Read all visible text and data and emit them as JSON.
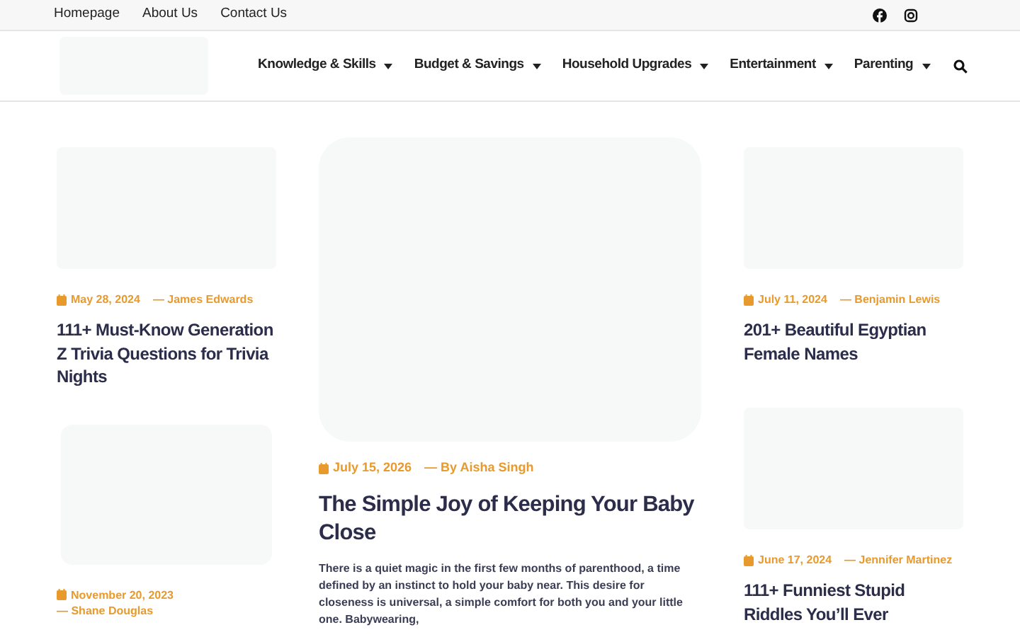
{
  "top_links": [
    "Homepage",
    "About Us",
    "Contact Us"
  ],
  "nav": [
    {
      "label": "Knowledge & Skills"
    },
    {
      "label": "Budget & Savings"
    },
    {
      "label": "Household Upgrades"
    },
    {
      "label": "Entertainment"
    },
    {
      "label": "Parenting"
    }
  ],
  "columns": [
    [
      {
        "date": "May 28, 2024",
        "author": "— James Edwards",
        "title": "111+ Must-Know Generation Z Trivia Questions for Trivia Nights"
      },
      {
        "date": "November 20, 2023",
        "author": "— Shane Douglas"
      }
    ],
    [
      {
        "date": "July 15, 2026",
        "author": "— By Aisha Singh",
        "title": "The Simple Joy of Keeping Your Baby Close",
        "excerpt": "There is a quiet magic in the first few months of parenthood, a time defined by an instinct to hold your baby near. This desire for closeness is universal, a simple comfort for both you and your little one. Babywearing,"
      }
    ],
    [
      {
        "date": "July 11, 2024",
        "author": "— Benjamin Lewis",
        "title": "201+ Beautiful Egyptian Female Names"
      },
      {
        "date": "June 17, 2024",
        "author": "— Jennifer Martinez",
        "title": "111+ Funniest Stupid Riddles You’ll Ever"
      }
    ]
  ]
}
